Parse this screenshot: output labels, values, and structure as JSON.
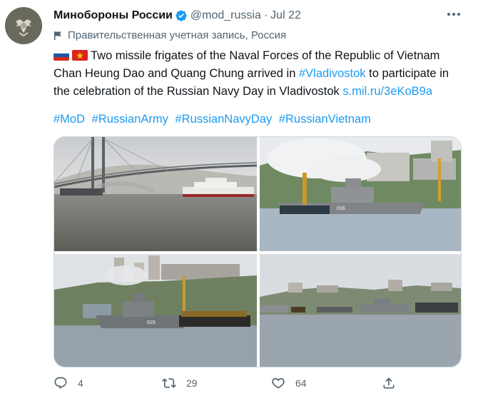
{
  "author": {
    "name": "Минобороны России",
    "handle": "@mod_russia",
    "separator": "·",
    "date": "Jul 22",
    "label": "Правительственная учетная запись, Россия"
  },
  "tweet": {
    "text_part1": "Two missile frigates of the Naval Forces of the Republic of Vietnam Chan Heung Dao and Quang Chung arrived in ",
    "mention_link": "#Vladivostok",
    "text_part2": " to participate in the celebration of the Russian Navy Day in Vladivostok ",
    "url": "s.mil.ru/3eKoB9a",
    "hashtags": [
      "#MoD",
      "#RussianArmy",
      "#RussianNavyDay",
      "#RussianVietnam"
    ]
  },
  "media": {
    "photos": [
      {
        "label": "bridge and ship photo"
      },
      {
        "label": "frigate 016 photo"
      },
      {
        "label": "frigate 015 photo"
      },
      {
        "label": "harbor panorama photo"
      }
    ],
    "ship_number_1": "016",
    "ship_number_2": "015"
  },
  "actions": {
    "reply_count": "4",
    "retweet_count": "29",
    "like_count": "64"
  },
  "colors": {
    "link": "#1d9bf0",
    "secondary": "#536471",
    "verified": "#1d9bf0"
  }
}
